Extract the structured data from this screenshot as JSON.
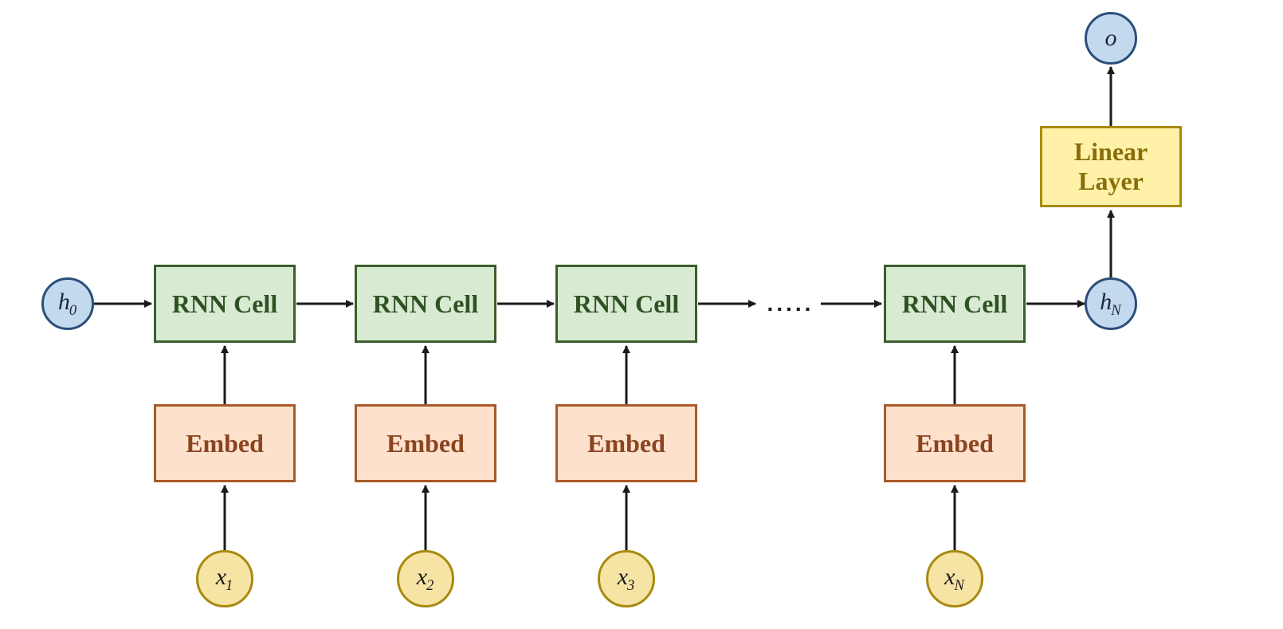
{
  "nodes": {
    "h0": {
      "var": "h",
      "sub": "0"
    },
    "hN": {
      "var": "h",
      "sub": "N"
    },
    "o": {
      "var": "o",
      "sub": ""
    },
    "x1": {
      "var": "x",
      "sub": "1"
    },
    "x2": {
      "var": "x",
      "sub": "2"
    },
    "x3": {
      "var": "x",
      "sub": "3"
    },
    "xN": {
      "var": "x",
      "sub": "N"
    }
  },
  "blocks": {
    "rnn_label": "RNN Cell",
    "embed_label": "Embed",
    "linear_label": "Linear\nLayer"
  },
  "misc": {
    "ellipsis": "....."
  },
  "colors": {
    "rnn_fill": "#d9ead3",
    "rnn_border": "#3b5d2a",
    "embed_fill": "#fde1cd",
    "embed_border": "#a85a28",
    "linear_fill": "#fff2a8",
    "linear_border": "#a88a10",
    "h_fill": "#c3d9ed",
    "h_border": "#2b4f7a",
    "x_fill": "#f6e4a5",
    "x_border": "#a88a10",
    "arrow": "#1a1a1a"
  }
}
